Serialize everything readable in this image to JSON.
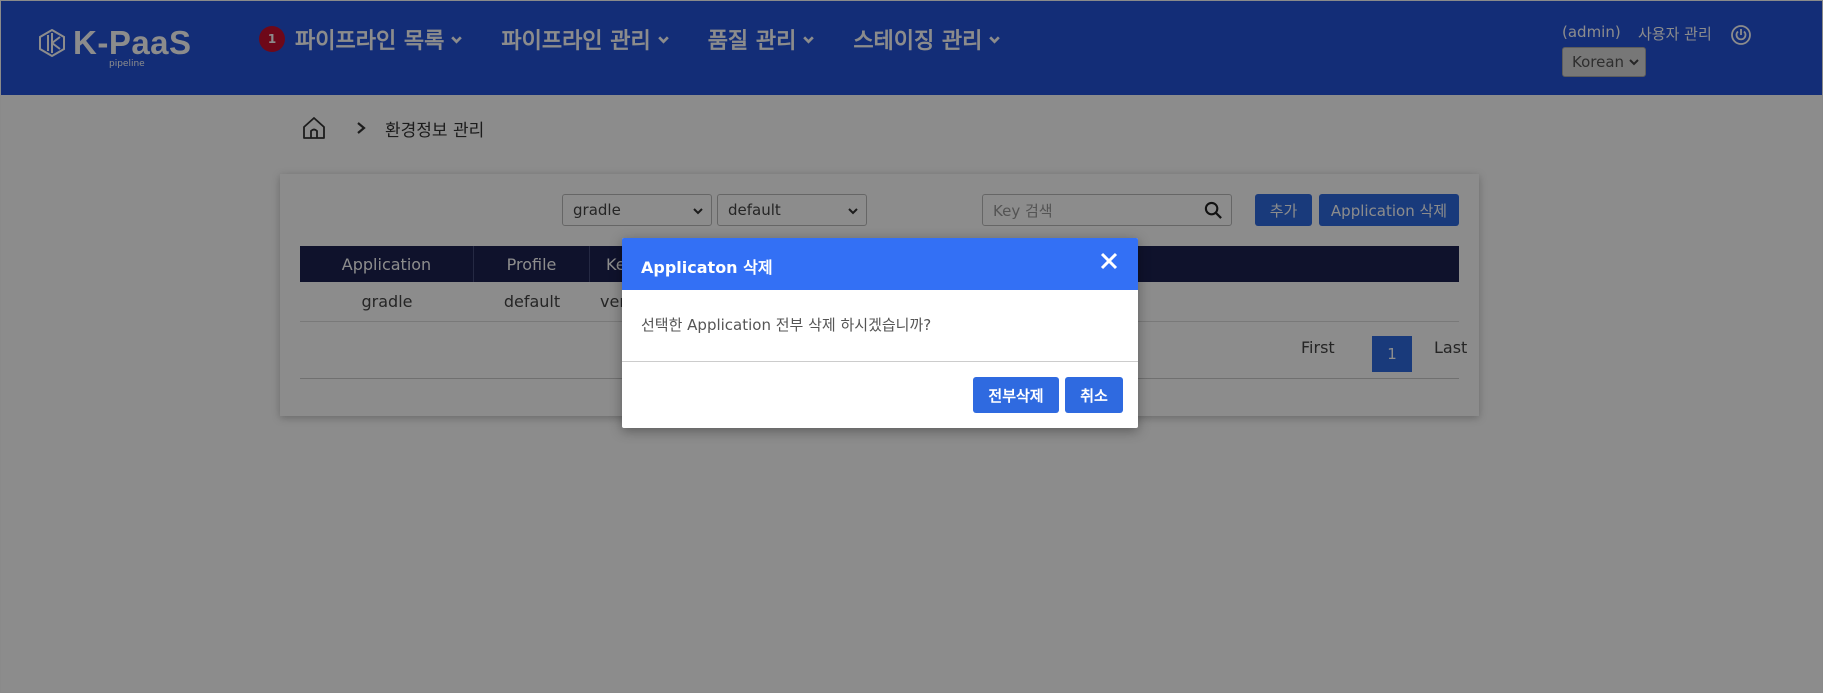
{
  "header": {
    "logo_text": "K-PaaS",
    "logo_sub": "pipeline",
    "nav": [
      {
        "label": "파이프라인 목록",
        "badge": "1"
      },
      {
        "label": "파이프라인 관리"
      },
      {
        "label": "품질 관리"
      },
      {
        "label": "스테이징 관리"
      }
    ],
    "admin_label": "(admin)",
    "user_manage_label": "사용자 관리",
    "language": "Korean"
  },
  "breadcrumb": {
    "current": "환경정보 관리"
  },
  "filters": {
    "application": "gradle",
    "profile": "default",
    "search_placeholder": "Key 검색"
  },
  "buttons": {
    "add": "추가",
    "delete_application": "Application 삭제"
  },
  "table": {
    "headers": {
      "application": "Application",
      "profile": "Profile",
      "key": "Ke"
    },
    "rows": [
      {
        "application": "gradle",
        "profile": "default",
        "key": "ver"
      }
    ]
  },
  "pagination": {
    "first": "First",
    "current": "1",
    "last": "Last"
  },
  "modal": {
    "title": "Applicaton 삭제",
    "message": "선택한 Application 전부 삭제 하시겠습니까?",
    "confirm": "전부삭제",
    "cancel": "취소"
  },
  "colors": {
    "header_bg": "#2352d9",
    "accent": "#2f6ae0",
    "modal_header": "#3370f5",
    "table_header": "#1c2150",
    "badge": "#c8102e"
  }
}
